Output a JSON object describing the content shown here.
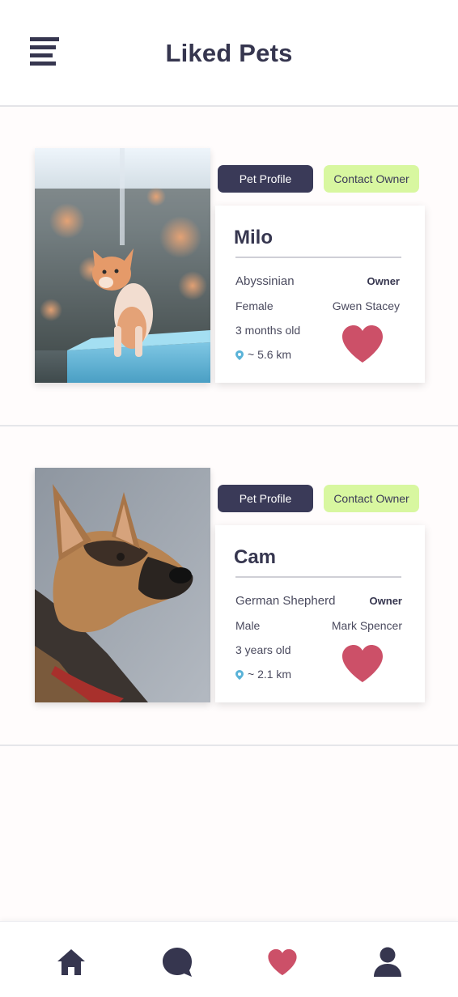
{
  "header": {
    "title": "Liked Pets",
    "menu_icon": "hamburger-menu-icon"
  },
  "pets": [
    {
      "name": "Milo",
      "breed": "Abyssinian",
      "sex": "Female",
      "age": "3 months old",
      "distance": "~ 5.6 km",
      "owner_label": "Owner",
      "owner_name": "Gwen Stacey",
      "profile_button": "Pet Profile",
      "contact_button": "Contact Owner",
      "photo": "orange-kitten-photo"
    },
    {
      "name": "Cam",
      "breed": "German Shepherd",
      "sex": "Male",
      "age": "3 years old",
      "distance": "~ 2.1 km",
      "owner_label": "Owner",
      "owner_name": "Mark Spencer",
      "profile_button": "Pet Profile",
      "contact_button": "Contact Owner",
      "photo": "german-shepherd-photo"
    }
  ],
  "nav": {
    "items": [
      {
        "icon": "home-icon",
        "active": false
      },
      {
        "icon": "chat-icon",
        "active": false
      },
      {
        "icon": "heart-icon",
        "active": true
      },
      {
        "icon": "user-icon",
        "active": false
      }
    ]
  },
  "colors": {
    "primary": "#3a3a58",
    "accent_green": "#d8f7a0",
    "heart": "#cc5068",
    "pin": "#5ab3d8"
  }
}
